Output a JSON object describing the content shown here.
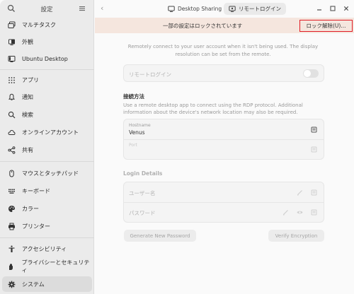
{
  "sidebar": {
    "title": "設定",
    "items": [
      {
        "label": "マルチタスク",
        "icon": "multitask-icon"
      },
      {
        "label": "外観",
        "icon": "appearance-icon"
      },
      {
        "label": "Ubuntu Desktop",
        "icon": "ubuntu-desktop-icon"
      },
      {
        "label": "アプリ",
        "icon": "apps-grid-icon"
      },
      {
        "label": "通知",
        "icon": "bell-icon"
      },
      {
        "label": "検索",
        "icon": "search-icon"
      },
      {
        "label": "オンラインアカウント",
        "icon": "online-accounts-icon"
      },
      {
        "label": "共有",
        "icon": "share-icon"
      },
      {
        "label": "マウスとタッチパッド",
        "icon": "mouse-icon"
      },
      {
        "label": "キーボード",
        "icon": "keyboard-icon"
      },
      {
        "label": "カラー",
        "icon": "palette-icon"
      },
      {
        "label": "プリンター",
        "icon": "printer-icon"
      },
      {
        "label": "アクセシビリティ",
        "icon": "accessibility-icon"
      },
      {
        "label": "プライバシーとセキュリティ",
        "icon": "privacy-hand-icon"
      },
      {
        "label": "システム",
        "icon": "system-gear-icon",
        "selected": true
      }
    ]
  },
  "header": {
    "breadcrumb_parent": "Desktop Sharing",
    "breadcrumb_current": "リモートログイン"
  },
  "banner": {
    "text": "一部の設定はロックされています",
    "unlock_label": "ロック解除(U)..."
  },
  "main": {
    "description": "Remotely connect to your user account when it isn't being used. The display resolution can be set from the remote.",
    "remote_login_label": "リモートログイン",
    "remote_login_enabled": false,
    "connection": {
      "title": "接続方法",
      "hint": "Use a remote desktop app to connect using the RDP protocol. Additional information about the device's network location may also be required.",
      "hostname_label": "Hostname",
      "hostname_value": "Venus",
      "port_label": "Port",
      "port_value": ""
    },
    "login": {
      "title": "Login Details",
      "username_placeholder": "ユーザー名",
      "password_placeholder": "パスワード"
    },
    "generate_button": "Generate New Password",
    "verify_button": "Verify Encryption"
  },
  "colors": {
    "banner_bg": "#f5e6de",
    "highlight_border": "#e01b24",
    "sidebar_bg": "#ebebeb"
  }
}
